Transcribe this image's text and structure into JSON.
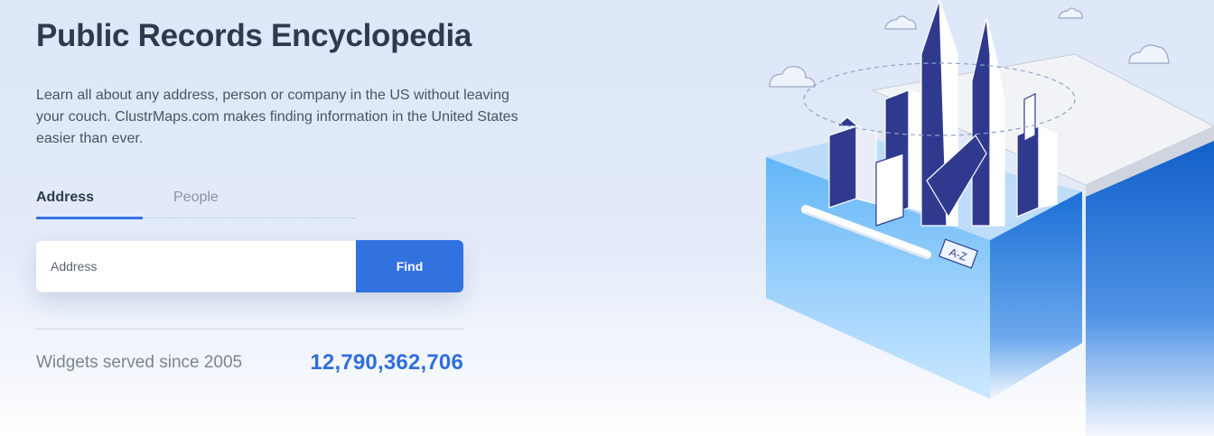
{
  "hero": {
    "title": "Public Records Encyclopedia",
    "description": "Learn all about any address, person or company in the US without leaving your couch. ClustrMaps.com makes finding information in the United States easier than ever."
  },
  "tabs": [
    {
      "label": "Address",
      "active": true
    },
    {
      "label": "People",
      "active": false
    }
  ],
  "search": {
    "placeholder": "Address",
    "value": "",
    "button_label": "Find"
  },
  "stats": {
    "label": "Widgets served since 2005",
    "count": "12,790,362,706"
  },
  "illustration": {
    "drawer_label": "A-Z"
  },
  "colors": {
    "accent": "#3271e0",
    "title": "#2f3a4d",
    "background": "#dde7f8",
    "building": "#2f3a8f",
    "drawer": "#5fb2f5"
  }
}
